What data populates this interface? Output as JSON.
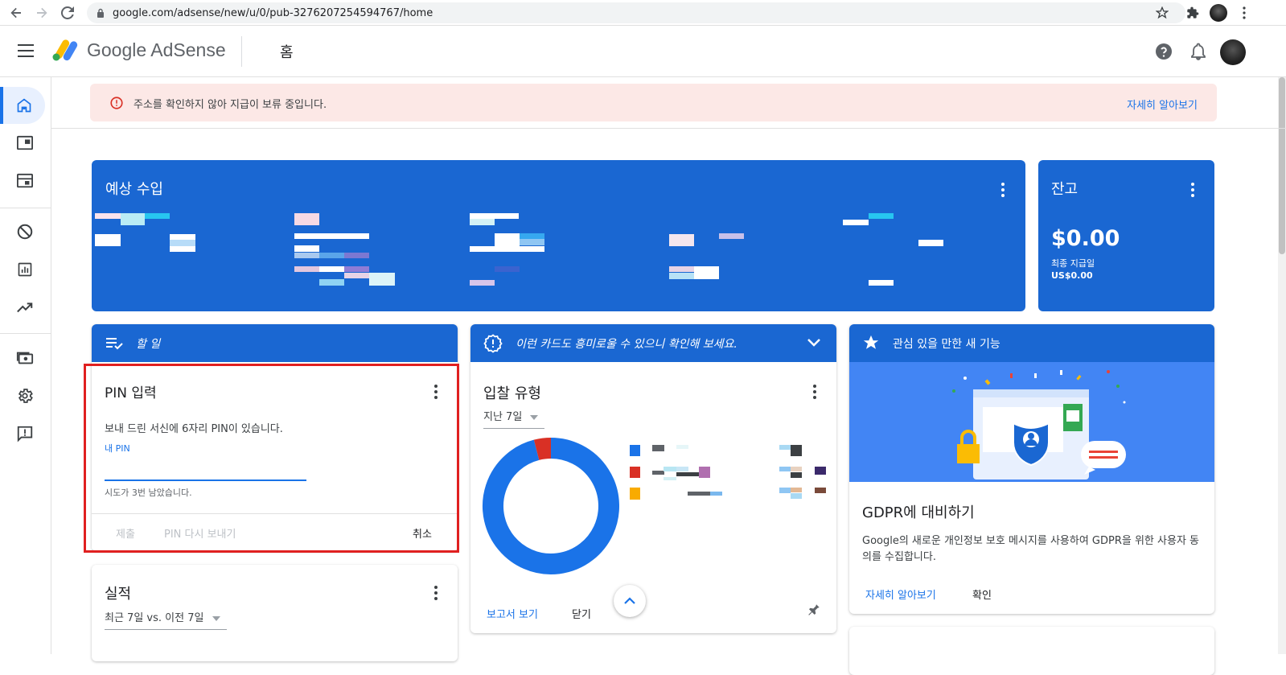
{
  "browser": {
    "url": "google.com/adsense/new/u/0/pub-3276207254594767/home"
  },
  "header": {
    "brand": "Google AdSense",
    "page_title": "홈"
  },
  "alert": {
    "message": "주소를 확인하지 않아 지급이 보류 중입니다.",
    "link": "자세히 알아보기"
  },
  "earnings": {
    "title": "예상 수입"
  },
  "balance": {
    "title": "잔고",
    "amount": "$0.00",
    "last_payment_label": "최종 지급일",
    "last_payment_value": "US$0.00"
  },
  "todo": {
    "header": "할 일",
    "pin": {
      "title": "PIN 입력",
      "description": "보내 드린 서신에 6자리 PIN이 있습니다.",
      "field_label": "내 PIN",
      "field_value": "",
      "hint": "시도가 3번 남았습니다.",
      "submit": "제출",
      "resend": "PIN 다시 보내기",
      "cancel": "취소"
    }
  },
  "performance": {
    "title": "실적",
    "range": "최근 7일 vs. 이전 7일"
  },
  "suggest": {
    "header": "이런 카드도 흥미로울 수 있으니 확인해 보세요.",
    "bid": {
      "title": "입찰 유형",
      "range": "지난 7일",
      "view_report": "보고서 보기",
      "close": "닫기"
    }
  },
  "features": {
    "header": "관심 있을 만한 새 기능",
    "gdpr": {
      "title": "GDPR에 대비하기",
      "description": "Google의 새로운 개인정보 보호 메시지를 사용하여 GDPR을 위한 사용자 동의를 수집합니다.",
      "learn_more": "자세히 알아보기",
      "confirm": "확인"
    }
  },
  "colors": {
    "blue": "#1a67d2",
    "link": "#1a73e8",
    "alert_bg": "#fce8e6",
    "alert_icon": "#d93025",
    "highlight": "#e02020"
  },
  "chart_data": {
    "type": "pie",
    "series": [
      {
        "value": 0.96,
        "color": "#1a73e8"
      },
      {
        "value": 0.04,
        "color": "#d93025"
      }
    ]
  }
}
